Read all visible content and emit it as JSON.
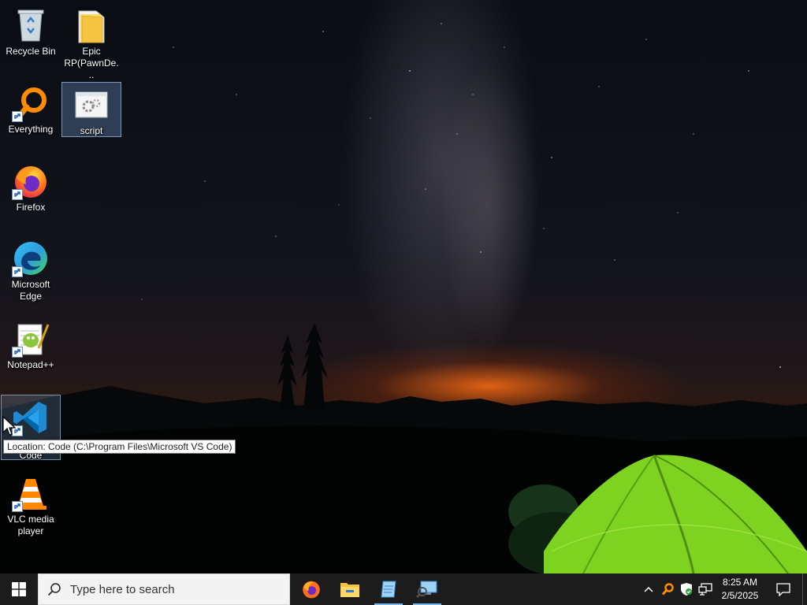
{
  "desktop": {
    "icons": [
      {
        "label": "Recycle Bin"
      },
      {
        "label": "Epic RP(PawnDe..."
      },
      {
        "label": "Everything"
      },
      {
        "label": "script"
      },
      {
        "label": "Firefox"
      },
      {
        "label": "Microsoft Edge"
      },
      {
        "label": "Notepad++"
      },
      {
        "label": "Visual Studio Code"
      },
      {
        "label": "VLC media player"
      }
    ],
    "tooltip": "Location: Code (C:\\Program Files\\Microsoft VS Code)"
  },
  "taskbar": {
    "search_placeholder": "Type here to search",
    "apps": [
      "firefox-icon",
      "file-explorer-icon",
      "notepad-app-icon",
      "remote-desktop-icon"
    ],
    "clock": {
      "time": "8:25 AM",
      "date": "2/5/2025"
    }
  },
  "colors": {
    "taskbar": "#1c1c1c",
    "accent": "#76b9ed",
    "tent": "#7ed321"
  }
}
